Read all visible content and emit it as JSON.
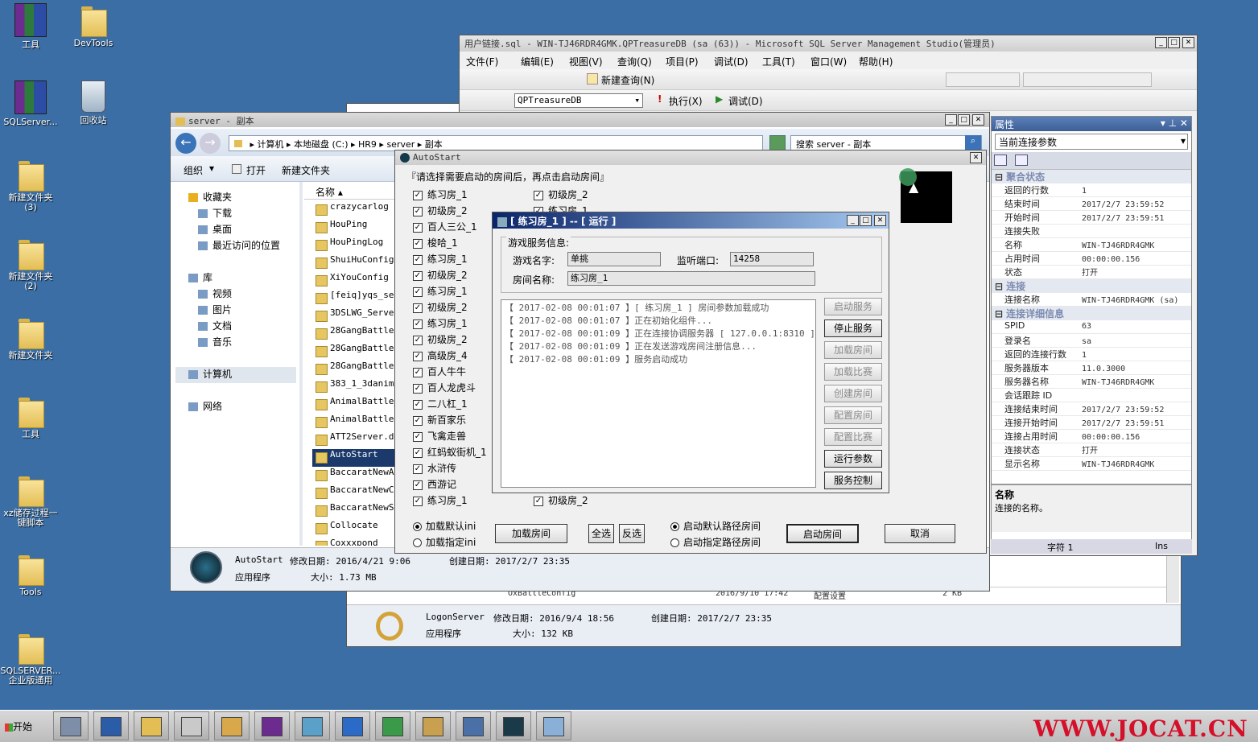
{
  "desktop": {
    "icons": [
      {
        "label": "工具",
        "type": "rar"
      },
      {
        "label": "DevTools",
        "type": "folder"
      },
      {
        "label": "SQLServer...",
        "type": "rar"
      },
      {
        "label": "回收站",
        "type": "bin"
      },
      {
        "label": "新建文件夹\n(3)",
        "type": "folder"
      },
      {
        "label": "新建文件夹\n(2)",
        "type": "folder"
      },
      {
        "label": "新建文件夹",
        "type": "folder"
      },
      {
        "label": "工具",
        "type": "folder"
      },
      {
        "label": "xz储存过程一\n键脚本",
        "type": "folder"
      },
      {
        "label": "Tools",
        "type": "folder"
      },
      {
        "label": "SQLSERVER...\n企业版通用",
        "type": "folder"
      }
    ]
  },
  "ssms": {
    "title": "用户链接.sql - WIN-TJ46RDR4GMK.QPTreasureDB (sa (63)) - Microsoft SQL Server Management Studio(管理员)",
    "menu": [
      "文件(F)",
      "编辑(E)",
      "视图(V)",
      "查询(Q)",
      "项目(P)",
      "调试(D)",
      "工具(T)",
      "窗口(W)",
      "帮助(H)"
    ],
    "new_query": "新建查询(N)",
    "database": "QPTreasureDB",
    "execute": "执行(X)",
    "debug": "调试(D)",
    "properties_title": "属性",
    "properties_dropdown": "当前连接参数",
    "sections": [
      {
        "name": "聚合状态",
        "rows": [
          [
            "返回的行数",
            "1"
          ],
          [
            "结束时间",
            "2017/2/7 23:59:52"
          ],
          [
            "开始时间",
            "2017/2/7 23:59:51"
          ],
          [
            "连接失败",
            ""
          ],
          [
            "名称",
            "WIN-TJ46RDR4GMK"
          ],
          [
            "占用时间",
            "00:00:00.156"
          ],
          [
            "状态",
            "打开"
          ]
        ]
      },
      {
        "name": "连接",
        "rows": [
          [
            "连接名称",
            "WIN-TJ46RDR4GMK (sa)"
          ]
        ]
      },
      {
        "name": "连接详细信息",
        "rows": [
          [
            "SPID",
            "63"
          ],
          [
            "登录名",
            "sa"
          ],
          [
            "返回的连接行数",
            "1"
          ],
          [
            "服务器版本",
            "11.0.3000"
          ],
          [
            "服务器名称",
            "WIN-TJ46RDR4GMK"
          ],
          [
            "会话跟踪 ID",
            ""
          ],
          [
            "连接结束时间",
            "2017/2/7 23:59:52"
          ],
          [
            "连接开始时间",
            "2017/2/7 23:59:51"
          ],
          [
            "连接占用时间",
            "00:00:00.156"
          ],
          [
            "连接状态",
            "打开"
          ],
          [
            "显示名称",
            "WIN-TJ46RDR4GMK"
          ]
        ]
      }
    ],
    "desc_title": "名称",
    "desc_text": "连接的名称。",
    "status_char": "字符 1",
    "status_ins": "Ins"
  },
  "explorer": {
    "title": "server - 副本",
    "path": [
      "计算机",
      "本地磁盘 (C:)",
      "HR9",
      "server",
      "副本"
    ],
    "search_placeholder": "搜索 server - 副本",
    "toolbar": [
      "组织",
      "打开",
      "新建文件夹"
    ],
    "nav": {
      "favorites": "收藏夹",
      "downloads": "下载",
      "desktop": "桌面",
      "recent": "最近访问的位置",
      "libraries": "库",
      "videos": "视频",
      "pictures": "图片",
      "docs": "文档",
      "music": "音乐",
      "computer": "计算机",
      "network": "网络"
    },
    "col_name": "名称",
    "files": [
      "crazycarlog",
      "HouPing",
      "HouPingLog",
      "ShuiHuConfig",
      "XiYouConfig",
      "[feiq]yqs_ser",
      "3DSLWG_Server",
      "28GangBattleA",
      "28GangBattleC",
      "28GangBattleS",
      "383_1_3danime",
      "AnimalBattle_",
      "AnimalBattleS",
      "ATT2Server.dl",
      "AutoStart",
      "BaccaratNewAr",
      "BaccaratNewCo",
      "BaccaratNewSe",
      "Collocate",
      "Coxxxpond"
    ],
    "selected": "AutoStart",
    "detail_name": "AutoStart",
    "detail_modified": "修改日期: 2016/4/21 9:06",
    "detail_created": "创建日期: 2017/2/7 23:35",
    "detail_type": "应用程序",
    "detail_size": "大小: 1.73 MB"
  },
  "back_window": {
    "row_name": "OxBattleConfig",
    "row_date": "2016/9/10 17:42",
    "row_type": "配置设置",
    "row_size": "2 KB",
    "detail_name": "LogonServer",
    "detail_modified": "修改日期: 2016/9/4 18:56",
    "detail_created": "创建日期: 2017/2/7 23:35",
    "detail_type": "应用程序",
    "detail_size": "大小: 132 KB"
  },
  "autostart": {
    "title": "AutoStart",
    "instruction": "『请选择需要启动的房间后，再点击启动房间』",
    "col1": [
      "练习房_1",
      "初级房_2",
      "百人三公_1",
      "梭哈_1",
      "练习房_1",
      "初级房_2",
      "练习房_1",
      "初级房_2",
      "练习房_1",
      "初级房_2",
      "高级房_4",
      "百人牛牛",
      "百人龙虎斗",
      "二八杠_1",
      "新百家乐",
      "飞禽走兽",
      "红蚂蚁街机_1",
      "水浒传",
      "西游记",
      "练习房_1"
    ],
    "col2_top": [
      "初级房_2",
      "练习房_1"
    ],
    "col2_bottom": "初级房_2",
    "radio_load_default": "加载默认ini",
    "radio_load_specified": "加载指定ini",
    "load_rooms": "加载房间",
    "select_all": "全选",
    "invert": "反选",
    "radio_default_path": "启动默认路径房间",
    "radio_specified_path": "启动指定路径房间",
    "start_rooms": "启动房间",
    "cancel": "取消"
  },
  "room_dialog": {
    "title": "[ 练习房_1 ] -- [ 运行 ]",
    "group": "游戏服务信息:",
    "game_name_label": "游戏名字:",
    "game_name": "单挑",
    "port_label": "监听端口:",
    "port": "14258",
    "room_name_label": "房间名称:",
    "room_name": "练习房_1",
    "logs": [
      "【 2017-02-08 00:01:07 】[ 练习房_1 ] 房间参数加载成功",
      "【 2017-02-08 00:01:07 】正在初始化组件...",
      "【 2017-02-08 00:01:09 】正在连接协调服务器 [ 127.0.0.1:8310 ]",
      "【 2017-02-08 00:01:09 】正在发送游戏房间注册信息...",
      "【 2017-02-08 00:01:09 】服务启动成功"
    ],
    "buttons": [
      {
        "label": "启动服务",
        "enabled": false
      },
      {
        "label": "停止服务",
        "enabled": true
      },
      {
        "label": "加载房间",
        "enabled": false
      },
      {
        "label": "加载比赛",
        "enabled": false
      },
      {
        "label": "创建房间",
        "enabled": false
      },
      {
        "label": "配置房间",
        "enabled": false
      },
      {
        "label": "配置比赛",
        "enabled": false
      },
      {
        "label": "运行参数",
        "enabled": true
      },
      {
        "label": "服务控制",
        "enabled": true
      }
    ]
  },
  "taskbar": {
    "start": "开始",
    "watermark": "WWW.JOCAT.CN"
  }
}
